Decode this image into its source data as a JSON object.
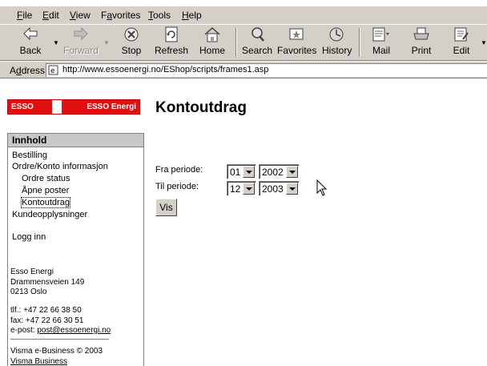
{
  "menu": {
    "items": [
      {
        "label": "File",
        "key": "F",
        "rest": "ile"
      },
      {
        "label": "Edit",
        "key": "E",
        "rest": "dit"
      },
      {
        "label": "View",
        "key": "V",
        "rest": "iew"
      },
      {
        "label": "Favorites",
        "key": "",
        "pre": "F",
        "key2": "a",
        "rest": "vorites"
      },
      {
        "label": "Tools",
        "key": "T",
        "rest": "ools"
      },
      {
        "label": "Help",
        "key": "H",
        "rest": "elp"
      }
    ]
  },
  "toolbar": {
    "back": "Back",
    "forward": "Forward",
    "stop": "Stop",
    "refresh": "Refresh",
    "home": "Home",
    "search": "Search",
    "favorites": "Favorites",
    "history": "History",
    "mail": "Mail",
    "print": "Print",
    "edit": "Edit"
  },
  "address": {
    "label_key": "d",
    "label_pre": "A",
    "label_rest": "dress",
    "url": "http://www.essoenergi.no/EShop/scripts/frames1.asp"
  },
  "logo": {
    "left": "ESSO",
    "right": "ESSO Energi"
  },
  "page": {
    "title": "Kontoutdrag"
  },
  "sidebar": {
    "header": "Innhold",
    "items": {
      "bestilling": "Bestilling",
      "ordre_konto": "Ordre/Konto informasjon",
      "ordre_status": "Ordre status",
      "apne_poster": "Åpne poster",
      "kontoutdrag": "Kontoutdrag",
      "kundeopplysninger": "Kundeopplysninger",
      "logg_inn": "Logg inn"
    },
    "contact": {
      "company": "Esso Energi",
      "street": "Drammensveien 149",
      "city": "0213 Oslo",
      "phone": "tlf.: +47 22 66 38 50",
      "fax": "fax: +47 22 66 30 51",
      "email_label": "e-post:",
      "email": "post@essoenergi.no"
    },
    "footer": {
      "copyright": "Visma e-Business © 2003",
      "link": "Visma Business"
    }
  },
  "form": {
    "fra_label": "Fra periode:",
    "til_label": "Til periode:",
    "fra_month": "01",
    "fra_year": "2002",
    "til_month": "12",
    "til_year": "2003",
    "submit": "Vis"
  }
}
